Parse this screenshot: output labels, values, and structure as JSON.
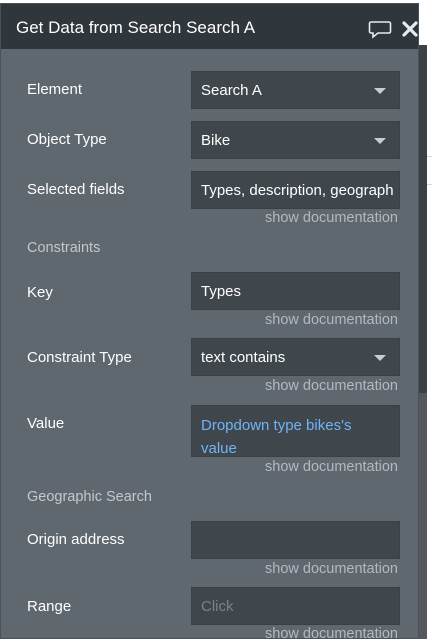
{
  "window": {
    "title": "Get Data from Search Search A"
  },
  "icons": {
    "comment": "comment-icon",
    "close": "close-icon"
  },
  "fields": {
    "element": {
      "label": "Element",
      "value": "Search A"
    },
    "object_type": {
      "label": "Object Type",
      "value": "Bike"
    },
    "selected_fields": {
      "label": "Selected fields",
      "value": "Types, description, geograph"
    },
    "key": {
      "label": "Key",
      "value": "Types"
    },
    "constraint_type": {
      "label": "Constraint Type",
      "value": "text contains"
    },
    "value": {
      "label": "Value",
      "value": "Dropdown type bikes's value"
    },
    "origin_address": {
      "label": "Origin address",
      "value": ""
    },
    "range": {
      "label": "Range",
      "placeholder": "Click"
    }
  },
  "sections": {
    "constraints": "Constraints",
    "geographic_search": "Geographic Search"
  },
  "doc_link": "show documentation",
  "colors": {
    "panel_bg": "#5f676f",
    "titlebar_bg": "#2f363c",
    "field_bg": "#3f464c",
    "dynamic_text": "#6fb4f7"
  }
}
